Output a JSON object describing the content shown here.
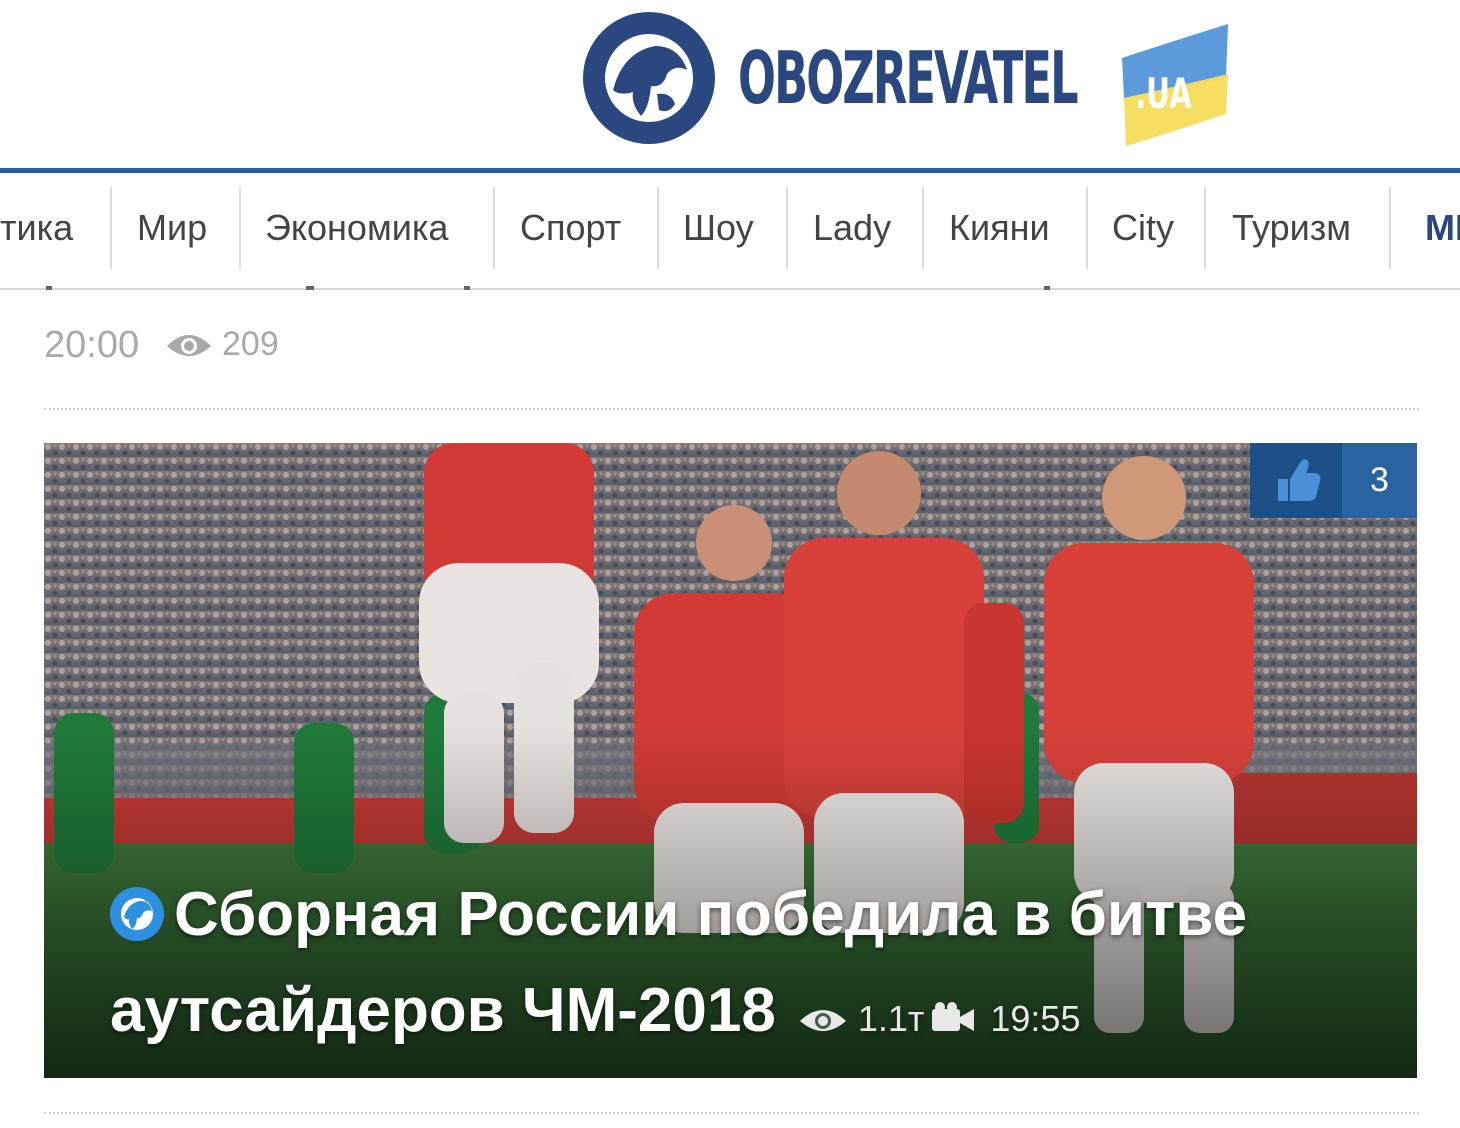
{
  "header": {
    "logo_text": "OBOZREVATEL",
    "logo_suffix": ".UA"
  },
  "nav": {
    "items": [
      {
        "label": "тика"
      },
      {
        "label": "Мир"
      },
      {
        "label": "Экономика"
      },
      {
        "label": "Спорт"
      },
      {
        "label": "Шоу"
      },
      {
        "label": "Lady"
      },
      {
        "label": "Кияни"
      },
      {
        "label": "City"
      },
      {
        "label": "Туризм"
      },
      {
        "label": "МІ"
      }
    ]
  },
  "prev_article": {
    "time": "20:00",
    "views": "209"
  },
  "feature": {
    "title": "Сборная России победила в битве аутсайдеров ЧМ-2018",
    "views": "1.1т",
    "time": "19:55",
    "likes": "3",
    "icons": [
      "globe-icon",
      "thumbs-up-icon",
      "eye-icon",
      "video-camera-icon"
    ]
  },
  "colors": {
    "brand_blue": "#2a4780",
    "nav_line": "#2a5ea0",
    "like_dark": "#1c4f86",
    "like_light": "#2a64a0",
    "flag_blue": "#4a8fd8",
    "flag_yellow": "#f6dc5a"
  }
}
